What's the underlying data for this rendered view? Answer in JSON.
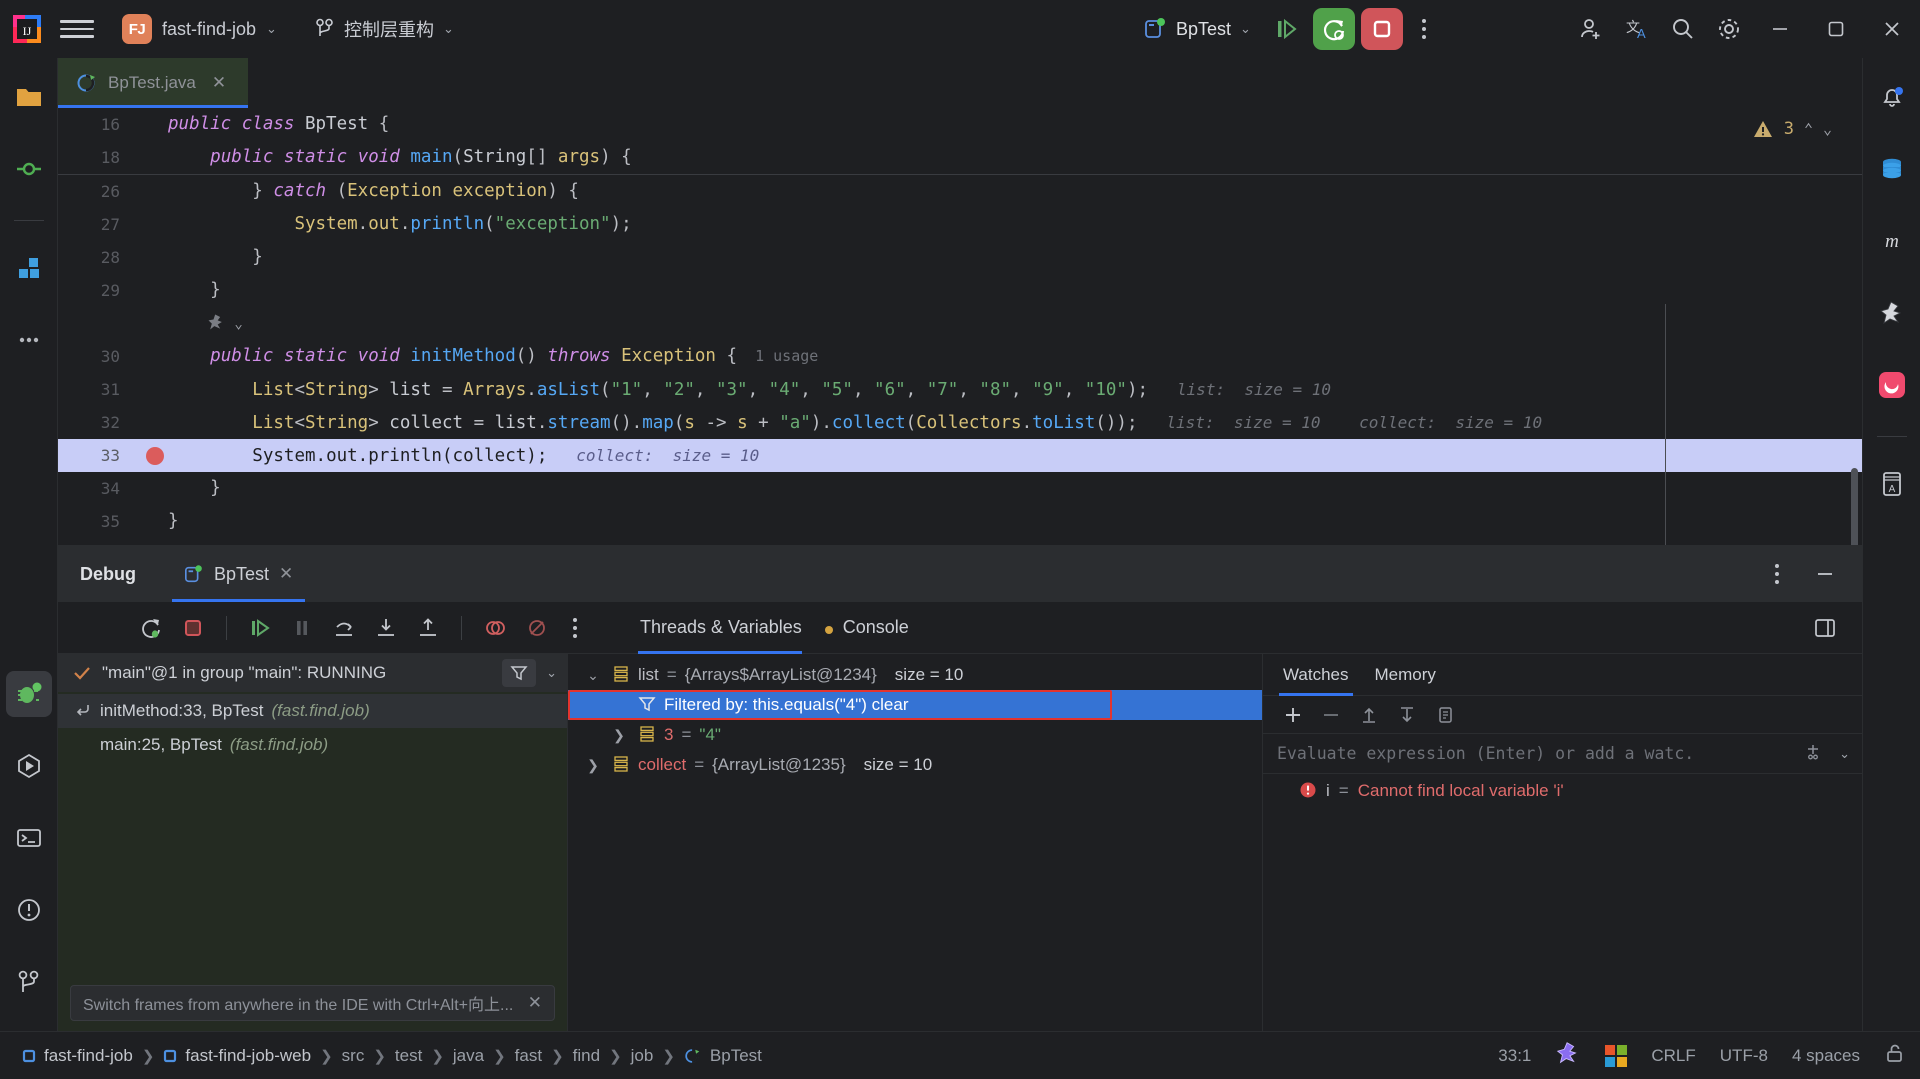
{
  "titlebar": {
    "menu_icon": "hamburger-icon",
    "project_badge": "FJ",
    "project_name": "fast-find-job",
    "branch_name": "控制层重构",
    "run_config": "BpTest",
    "icons": {
      "debug_run": "debug-step-icon",
      "rerun": "rerun-debug-icon",
      "stop": "stop-icon",
      "more": "more-options-icon",
      "add_user": "add-user-icon",
      "translate": "translate-icon",
      "search": "search-icon",
      "settings": "settings-gear-icon",
      "minimize": "minimize-icon",
      "maximize": "maximize-icon",
      "close": "close-icon"
    }
  },
  "left_rail": [
    {
      "name": "project-tool-icon",
      "label": "Project"
    },
    {
      "name": "commit-tool-icon",
      "label": "Commit"
    },
    {
      "name": "structure-tool-icon",
      "label": "Structure"
    },
    {
      "name": "more-tools-icon",
      "label": "More tools"
    },
    {
      "name": "debug-tool-icon",
      "label": "Debug",
      "active": true
    },
    {
      "name": "run-tool-icon",
      "label": "Run"
    },
    {
      "name": "terminal-tool-icon",
      "label": "Terminal"
    },
    {
      "name": "problems-tool-icon",
      "label": "Problems"
    },
    {
      "name": "version-control-icon",
      "label": "Version Control"
    }
  ],
  "right_rail": [
    {
      "name": "notifications-icon",
      "label": "Notifications"
    },
    {
      "name": "database-icon",
      "label": "Database"
    },
    {
      "name": "maven-icon",
      "label": "Maven"
    },
    {
      "name": "ai-assistant-icon",
      "label": "AI Assistant"
    },
    {
      "name": "plugin-icon",
      "label": "Plugin"
    },
    {
      "name": "translation-dict-icon",
      "label": "Dictionary"
    }
  ],
  "editor": {
    "tab_name": "BpTest.java",
    "tab_icon": "java-test-class-icon",
    "warning_count": "3",
    "lines": [
      {
        "no": "16",
        "type": "code",
        "indent": 0,
        "tokens": [
          {
            "t": "public ",
            "c": "kw"
          },
          {
            "t": "class ",
            "c": "kw"
          },
          {
            "t": "BpTest",
            "c": "typ"
          },
          {
            "t": " {",
            "c": "pun"
          }
        ]
      },
      {
        "no": "18",
        "type": "code",
        "indent": 1,
        "tokens": [
          {
            "t": "public ",
            "c": "kw"
          },
          {
            "t": "static ",
            "c": "kw"
          },
          {
            "t": "void ",
            "c": "kw"
          },
          {
            "t": "main",
            "c": "fn"
          },
          {
            "t": "(",
            "c": "pun"
          },
          {
            "t": "String",
            "c": "typ"
          },
          {
            "t": "[] ",
            "c": "pun"
          },
          {
            "t": "args",
            "c": "cls"
          },
          {
            "t": ") {",
            "c": "pun"
          }
        ]
      },
      {
        "no": "26",
        "type": "code",
        "indent": 2,
        "tokens": [
          {
            "t": "} ",
            "c": "pun"
          },
          {
            "t": "catch ",
            "c": "kw"
          },
          {
            "t": "(",
            "c": "pun"
          },
          {
            "t": "Exception",
            "c": "cls"
          },
          {
            "t": " ",
            "c": "pun"
          },
          {
            "t": "exception",
            "c": "cls"
          },
          {
            "t": ") {",
            "c": "pun"
          }
        ]
      },
      {
        "no": "27",
        "type": "code",
        "indent": 3,
        "tokens": [
          {
            "t": "System",
            "c": "cls"
          },
          {
            "t": ".",
            "c": "pun"
          },
          {
            "t": "out",
            "c": "cls"
          },
          {
            "t": ".",
            "c": "pun"
          },
          {
            "t": "println",
            "c": "fn"
          },
          {
            "t": "(",
            "c": "pun"
          },
          {
            "t": "\"exception\"",
            "c": "str"
          },
          {
            "t": ");",
            "c": "pun"
          }
        ]
      },
      {
        "no": "28",
        "type": "code",
        "indent": 2,
        "tokens": [
          {
            "t": "}",
            "c": "pun"
          }
        ]
      },
      {
        "no": "29",
        "type": "code",
        "indent": 1,
        "tokens": [
          {
            "t": "}",
            "c": "pun"
          }
        ]
      },
      {
        "no": "",
        "type": "gutter-icon",
        "indent": 1,
        "icon": "ai-suggestion-icon"
      },
      {
        "no": "30",
        "type": "code",
        "indent": 1,
        "tokens": [
          {
            "t": "public ",
            "c": "kw"
          },
          {
            "t": "static ",
            "c": "kw"
          },
          {
            "t": "void ",
            "c": "kw"
          },
          {
            "t": "initMethod",
            "c": "fn"
          },
          {
            "t": "() ",
            "c": "pun"
          },
          {
            "t": "throws ",
            "c": "kw"
          },
          {
            "t": "Exception",
            "c": "cls"
          },
          {
            "t": " {",
            "c": "pun"
          }
        ],
        "usage": "1 usage"
      },
      {
        "no": "31",
        "type": "code",
        "indent": 2,
        "tokens": [
          {
            "t": "List",
            "c": "cls"
          },
          {
            "t": "<",
            "c": "pun"
          },
          {
            "t": "String",
            "c": "cls"
          },
          {
            "t": "> ",
            "c": "pun"
          },
          {
            "t": "list",
            "c": "id"
          },
          {
            "t": " = ",
            "c": "pun"
          },
          {
            "t": "Arrays",
            "c": "cls"
          },
          {
            "t": ".",
            "c": "pun"
          },
          {
            "t": "asList",
            "c": "fn"
          },
          {
            "t": "(",
            "c": "pun"
          },
          {
            "t": "\"1\"",
            "c": "str"
          },
          {
            "t": ", ",
            "c": "pun"
          },
          {
            "t": "\"2\"",
            "c": "str"
          },
          {
            "t": ", ",
            "c": "pun"
          },
          {
            "t": "\"3\"",
            "c": "str"
          },
          {
            "t": ", ",
            "c": "pun"
          },
          {
            "t": "\"4\"",
            "c": "str"
          },
          {
            "t": ", ",
            "c": "pun"
          },
          {
            "t": "\"5\"",
            "c": "str"
          },
          {
            "t": ", ",
            "c": "pun"
          },
          {
            "t": "\"6\"",
            "c": "str"
          },
          {
            "t": ", ",
            "c": "pun"
          },
          {
            "t": "\"7\"",
            "c": "str"
          },
          {
            "t": ", ",
            "c": "pun"
          },
          {
            "t": "\"8\"",
            "c": "str"
          },
          {
            "t": ", ",
            "c": "pun"
          },
          {
            "t": "\"9\"",
            "c": "str"
          },
          {
            "t": ", ",
            "c": "pun"
          },
          {
            "t": "\"10\"",
            "c": "str"
          },
          {
            "t": ");",
            "c": "pun"
          }
        ],
        "hints": [
          "list:  size = 10"
        ]
      },
      {
        "no": "32",
        "type": "code",
        "indent": 2,
        "tokens": [
          {
            "t": "List",
            "c": "cls"
          },
          {
            "t": "<",
            "c": "pun"
          },
          {
            "t": "String",
            "c": "cls"
          },
          {
            "t": "> ",
            "c": "pun"
          },
          {
            "t": "collect",
            "c": "id"
          },
          {
            "t": " = ",
            "c": "pun"
          },
          {
            "t": "list",
            "c": "id"
          },
          {
            "t": ".",
            "c": "pun"
          },
          {
            "t": "stream",
            "c": "fn"
          },
          {
            "t": "().",
            "c": "pun"
          },
          {
            "t": "map",
            "c": "fn"
          },
          {
            "t": "(",
            "c": "pun"
          },
          {
            "t": "s",
            "c": "cls"
          },
          {
            "t": " -> ",
            "c": "pun"
          },
          {
            "t": "s",
            "c": "cls"
          },
          {
            "t": " + ",
            "c": "pun"
          },
          {
            "t": "\"a\"",
            "c": "str"
          },
          {
            "t": ").",
            "c": "pun"
          },
          {
            "t": "collect",
            "c": "fn"
          },
          {
            "t": "(",
            "c": "pun"
          },
          {
            "t": "Collectors",
            "c": "cls"
          },
          {
            "t": ".",
            "c": "pun"
          },
          {
            "t": "toList",
            "c": "fn"
          },
          {
            "t": "());",
            "c": "pun"
          }
        ],
        "hints": [
          "list:  size = 10",
          "collect:  size = 10"
        ]
      },
      {
        "no": "33",
        "type": "code",
        "indent": 2,
        "highlight": true,
        "breakpoint": true,
        "tokens": [
          {
            "t": "System",
            "c": "cls"
          },
          {
            "t": ".",
            "c": "pun"
          },
          {
            "t": "out",
            "c": "pun"
          },
          {
            "t": ".",
            "c": "pun"
          },
          {
            "t": "println",
            "c": "pun"
          },
          {
            "t": "(",
            "c": "pun"
          },
          {
            "t": "collect",
            "c": "pun"
          },
          {
            "t": ");",
            "c": "pun"
          }
        ],
        "hints": [
          "collect:  size = 10"
        ]
      },
      {
        "no": "34",
        "type": "code",
        "indent": 1,
        "tokens": [
          {
            "t": "}",
            "c": "pun"
          }
        ]
      },
      {
        "no": "35",
        "type": "code",
        "indent": 0,
        "tokens": [
          {
            "t": "}",
            "c": "pun"
          }
        ]
      }
    ]
  },
  "debug": {
    "title": "Debug",
    "session_tab": "BpTest",
    "toolbar_icons": [
      {
        "name": "rerun-icon"
      },
      {
        "name": "stop-icon"
      },
      {
        "name": "resume-program-icon"
      },
      {
        "name": "pause-program-icon"
      },
      {
        "name": "step-over-icon"
      },
      {
        "name": "step-into-icon"
      },
      {
        "name": "step-out-icon"
      },
      {
        "name": "view-breakpoints-icon"
      },
      {
        "name": "mute-breakpoints-icon"
      },
      {
        "name": "more-debug-options-icon"
      }
    ],
    "tabs": [
      {
        "label": "Threads & Variables",
        "active": true,
        "icon": ""
      },
      {
        "label": "Console",
        "active": false,
        "icon": "console-warning-icon"
      }
    ],
    "layout_icon": "layout-settings-icon",
    "settings_icon": "debug-settings-icon",
    "minimize_icon": "minimize-panel-icon",
    "frames": {
      "thread": "\"main\"@1 in group \"main\": RUNNING",
      "thread_status_icon": "thread-running-check-icon",
      "filter_icon": "filter-icon",
      "chevron_icon": "chevron-down-icon",
      "items": [
        {
          "text": "initMethod:33, BpTest",
          "pkg": "(fast.find.job)",
          "selected": true,
          "icon": "frame-return-icon"
        },
        {
          "text": "main:25, BpTest",
          "pkg": "(fast.find.job)",
          "selected": false,
          "icon": ""
        }
      ],
      "hint": "Switch frames from anywhere in the IDE with Ctrl+Alt+向上...",
      "hint_close_icon": "close-icon"
    },
    "variables": [
      {
        "indent": 0,
        "arrow": "expanded",
        "icon": "array-icon",
        "name": "list",
        "eq": " = ",
        "value": "{Arrays$ArrayList@1234}",
        "size": "size = 10",
        "selected": false
      },
      {
        "indent": 1,
        "arrow": "none",
        "icon": "filter-icon",
        "name": "Filtered by: this.equals(\"4\") clear",
        "eq": "",
        "value": "",
        "size": "",
        "selected": true,
        "outlined": true
      },
      {
        "indent": 1,
        "arrow": "collapsed",
        "icon": "array-icon",
        "name": "3",
        "eq": " = ",
        "value": "\"4\"",
        "size": "",
        "selected": false,
        "name_color": "red",
        "value_color": "str"
      },
      {
        "indent": 0,
        "arrow": "collapsed",
        "icon": "array-icon",
        "name": "collect",
        "eq": " = ",
        "value": "{ArrayList@1235}",
        "size": "size = 10",
        "selected": false,
        "name_color": "red"
      }
    ],
    "watches": {
      "tabs": [
        {
          "label": "Watches",
          "active": true
        },
        {
          "label": "Memory",
          "active": false
        }
      ],
      "toolbar_icons": [
        {
          "name": "add-watch-icon",
          "glyph": "+"
        },
        {
          "name": "remove-watch-icon",
          "glyph": "−"
        },
        {
          "name": "move-watch-up-icon",
          "glyph": "↑"
        },
        {
          "name": "move-watch-down-icon",
          "glyph": "↓"
        },
        {
          "name": "copy-watch-icon",
          "glyph": "▤"
        }
      ],
      "input_placeholder": "Evaluate expression (Enter) or add a watc.",
      "input_value": "",
      "expand_icon": "expand-editor-icon",
      "history_icon": "chevron-down-icon",
      "rows": [
        {
          "icon": "error-icon",
          "name": "i",
          "eq": " = ",
          "value": "Cannot find local variable 'i'"
        }
      ]
    }
  },
  "status_bar": {
    "breadcrumbs": [
      {
        "label": "fast-find-job",
        "icon": "module-icon"
      },
      {
        "label": "fast-find-job-web",
        "icon": "module-icon"
      },
      {
        "label": "src",
        "icon": ""
      },
      {
        "label": "test",
        "icon": ""
      },
      {
        "label": "java",
        "icon": ""
      },
      {
        "label": "fast",
        "icon": ""
      },
      {
        "label": "find",
        "icon": ""
      },
      {
        "label": "job",
        "icon": ""
      },
      {
        "label": "BpTest",
        "icon": "java-test-class-icon"
      }
    ],
    "caret": "33:1",
    "line_sep": "CRLF",
    "encoding": "UTF-8",
    "indent": "4 spaces",
    "ai_icon": "ai-assistant-icon",
    "os_icon": "windows-icon",
    "lock_icon": "unlocked-icon"
  },
  "colors": {
    "accent_blue": "#3574f0",
    "run_green": "#50a14a",
    "stop_red": "#d0555a",
    "selection_blue": "#3573d4",
    "error_red": "#e06c6c",
    "highlight_line": "#c8cdf7",
    "outline_red": "#e3342f"
  }
}
